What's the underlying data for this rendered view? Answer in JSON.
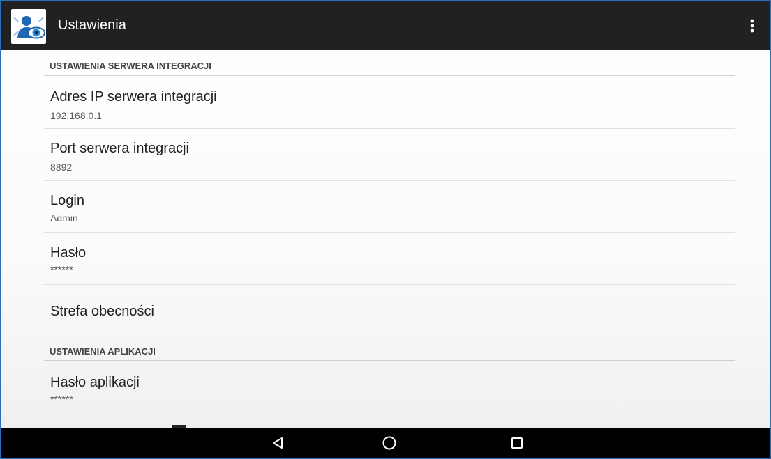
{
  "appbar": {
    "title": "Ustawienia",
    "icon": "person-eye-app-icon",
    "menu_icon": "overflow-menu-icon"
  },
  "sections": [
    {
      "header": "USTAWIENIA SERWERA INTEGRACJI",
      "items": [
        {
          "title": "Adres IP serwera integracji",
          "summary": "192.168.0.1"
        },
        {
          "title": "Port serwera integracji",
          "summary": "8892"
        },
        {
          "title": "Login",
          "summary": "Admin"
        },
        {
          "title": "Hasło",
          "summary": "******"
        },
        {
          "title": "Strefa obecności",
          "summary": ""
        }
      ]
    },
    {
      "header": "USTAWIENIA APLIKACJI",
      "items": [
        {
          "title": "Hasło aplikacji",
          "summary": "******"
        }
      ]
    }
  ],
  "navbar": {
    "back_icon": "back-triangle-icon",
    "home_icon": "home-circle-icon",
    "recents_icon": "recents-square-icon"
  },
  "colors": {
    "appbar": "#212121",
    "navbar": "#000000",
    "accent": "#1e88e5"
  }
}
